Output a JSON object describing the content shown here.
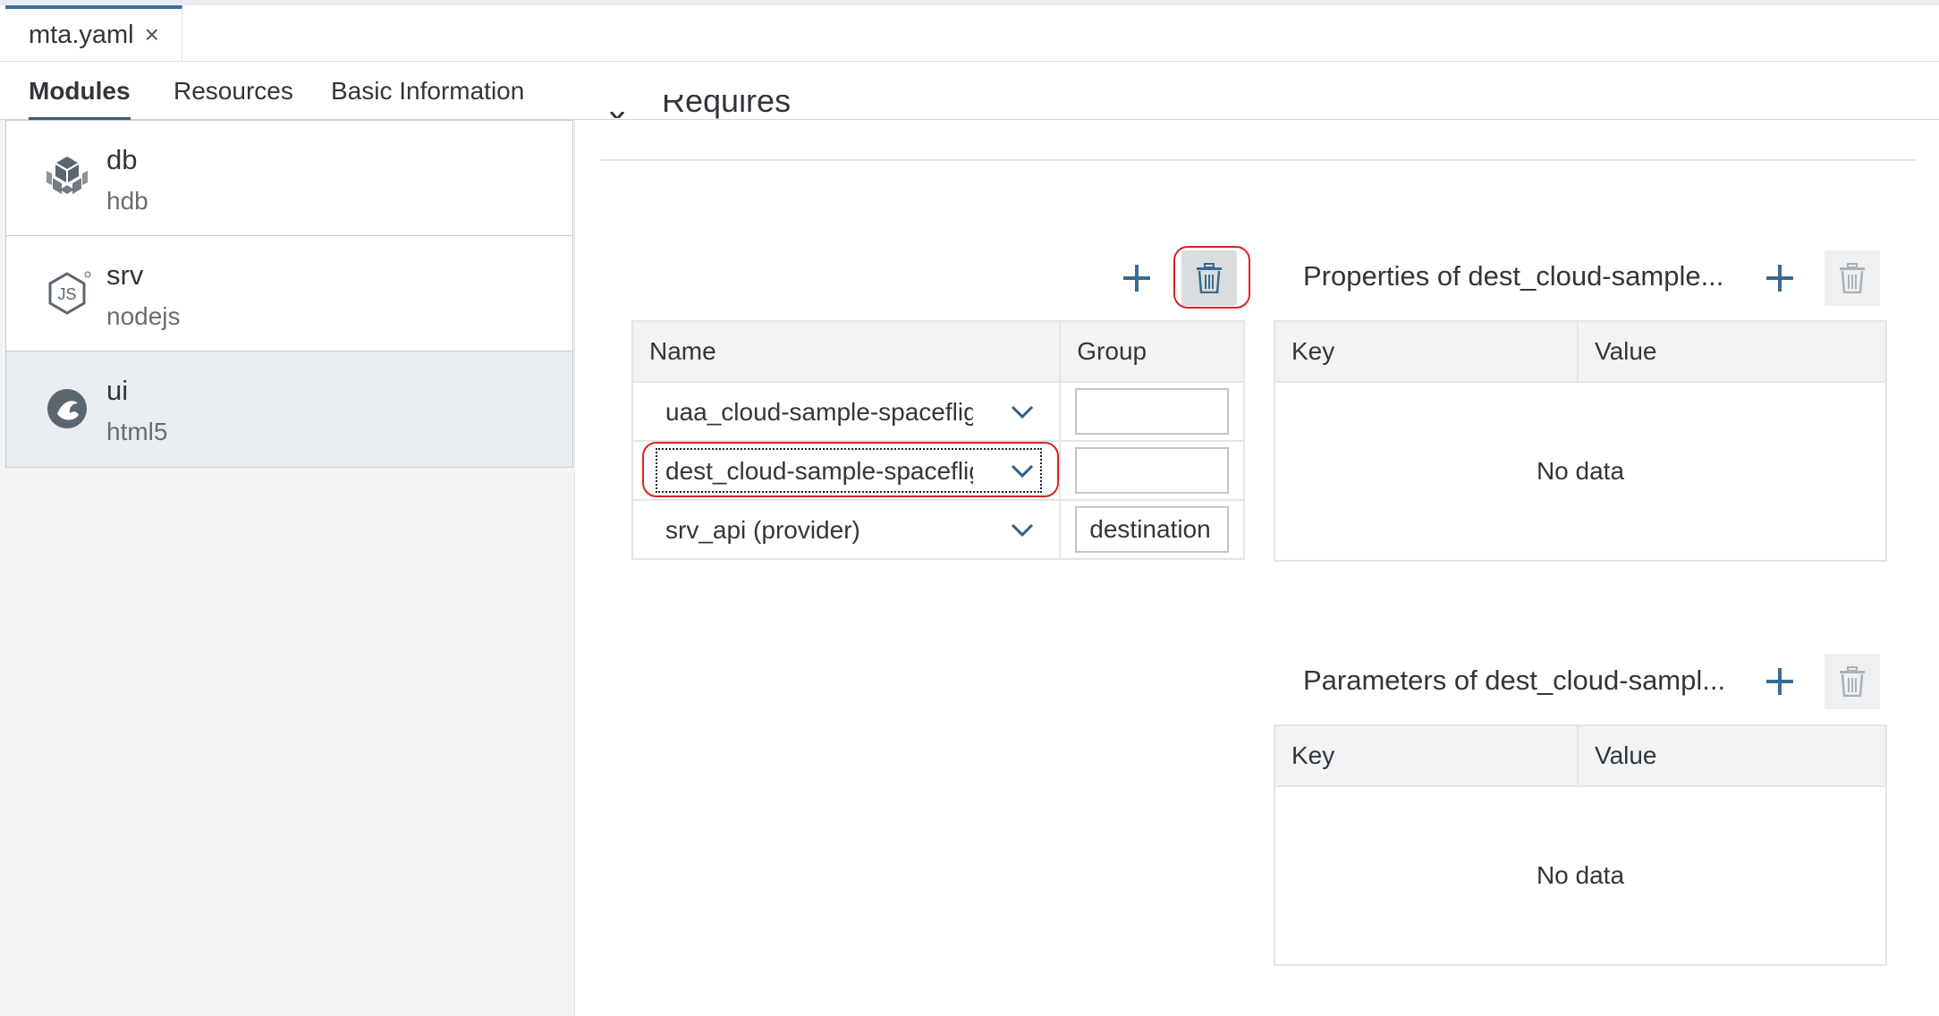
{
  "file_tab": {
    "name": "mta.yaml",
    "close_glyph": "×"
  },
  "tabs": [
    {
      "label": "Modules",
      "active": true
    },
    {
      "label": "Resources",
      "active": false
    },
    {
      "label": "Basic Information",
      "active": false
    }
  ],
  "modules": [
    {
      "name": "db",
      "type": "hdb",
      "icon": "hdb-cube-icon"
    },
    {
      "name": "srv",
      "type": "nodejs",
      "icon": "nodejs-icon"
    },
    {
      "name": "ui",
      "type": "html5",
      "icon": "html5-phoenix-icon",
      "selected": true
    }
  ],
  "section": {
    "title": "Requires"
  },
  "requires_table": {
    "headers": {
      "name": "Name",
      "group": "Group"
    },
    "rows": [
      {
        "name": "uaa_cloud-sample-spaceflight",
        "group": ""
      },
      {
        "name": "dest_cloud-sample-spaceflight",
        "group": ""
      },
      {
        "name": "srv_api (provider)",
        "group": "destination"
      }
    ]
  },
  "properties_panel": {
    "title": "Properties of dest_cloud-sample...",
    "headers": {
      "key": "Key",
      "value": "Value"
    },
    "empty_text": "No data"
  },
  "parameters_panel": {
    "title": "Parameters of dest_cloud-sampl...",
    "headers": {
      "key": "Key",
      "value": "Value"
    },
    "empty_text": "No data"
  },
  "colors": {
    "accent": "#2f5f8a",
    "highlight": "#d8231c",
    "icon": "#3a6a91",
    "disabled_icon": "#a9b1b9"
  }
}
